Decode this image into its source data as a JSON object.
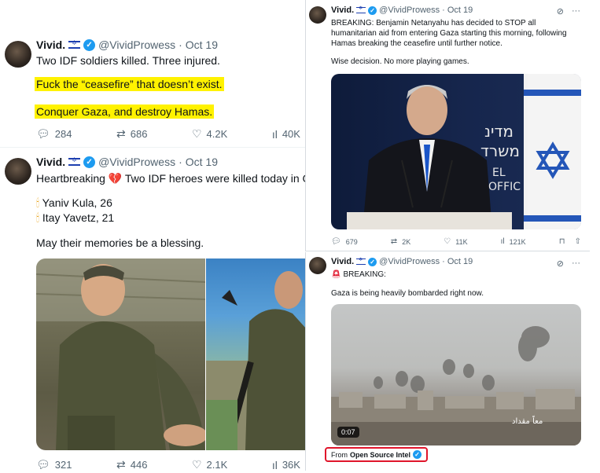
{
  "tweet1": {
    "name": "Vivid.",
    "handle": "@VividProwess",
    "date": "Oct 19",
    "line1": "Two IDF soldiers killed. Three injured.",
    "line2": "Fuck the “ceasefire” that doesn’t exist.",
    "line3": "Conquer Gaza, and destroy Hamas.",
    "replies": "284",
    "reposts": "686",
    "likes": "4.2K",
    "views": "40K"
  },
  "tweet2": {
    "name": "Vivid.",
    "handle": "@VividProwess",
    "date": "Oct 19",
    "line1": "Heartbreaking 💔 Two IDF heroes were killed today in Gaza.",
    "soldier1": "Yaniv Kula, 26",
    "soldier2": "Itay Yavetz, 21",
    "line3": "May their memories be a blessing.",
    "replies": "321",
    "reposts": "446",
    "likes": "2.1K",
    "views": "36K"
  },
  "tweet3": {
    "name": "Vivid.",
    "handle": "@VividProwess",
    "date": "Oct 19",
    "body": "BREAKING: Benjamin Netanyahu has decided to STOP all humanitarian aid from entering Gaza starting this morning, following Hamas breaking the ceasefire until further notice.",
    "line2": "Wise decision. No more playing games.",
    "backdrop_text_1": "מדינ",
    "backdrop_text_2": "משרד",
    "backdrop_text_3": "EL",
    "backdrop_text_4": "OFFIC",
    "replies": "679",
    "reposts": "2K",
    "likes": "11K",
    "views": "121K"
  },
  "tweet4": {
    "name": "Vivid.",
    "handle": "@VividProwess",
    "date": "Oct 19",
    "breaking": "BREAKING:",
    "body": "Gaza is being heavily bombarded right now.",
    "video_time": "0:07",
    "video_caption": "معاً مقداد",
    "from_label": "From",
    "from_source": "Open Source Intel"
  },
  "icons": {
    "reply": "reply-icon",
    "repost": "repost-icon",
    "like": "heart-icon",
    "views": "views-icon",
    "bookmark": "bookmark-icon",
    "share": "share-icon",
    "more": "more-icon",
    "grok": "grok-icon"
  },
  "colors": {
    "highlight": "#fff200",
    "verified": "#1d9bf0",
    "source_outline": "#e0152b"
  }
}
